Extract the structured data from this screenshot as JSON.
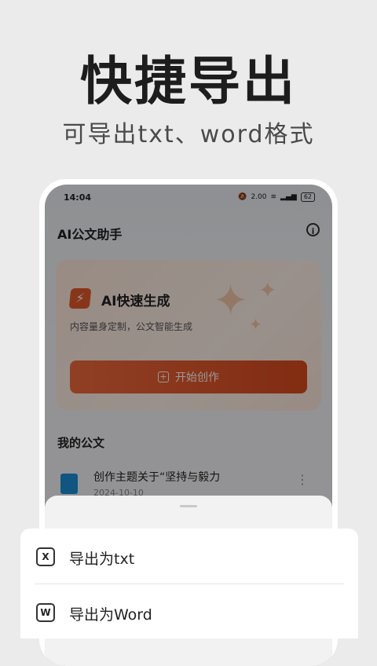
{
  "promo": {
    "headline": "快捷导出",
    "subheadline": "可导出txt、word格式"
  },
  "statusbar": {
    "time": "14:04",
    "speed": "2.00",
    "battery": "62"
  },
  "app": {
    "title": "AI公文助手",
    "info_icon": "i"
  },
  "hero": {
    "title": "AI快速生成",
    "subtitle": "内容量身定制，公文智能生成",
    "button_label": "开始创作"
  },
  "my_docs": {
    "section_title": "我的公文",
    "items": [
      {
        "title": "创作主题关于“坚持与毅力",
        "date": "2024-10-10"
      }
    ]
  },
  "export_menu": {
    "items": [
      {
        "icon_letter": "X",
        "label": "导出为txt"
      },
      {
        "icon_letter": "W",
        "label": "导出为Word"
      }
    ]
  },
  "colors": {
    "accent": "#e35b2c",
    "background": "#ebebeb"
  }
}
